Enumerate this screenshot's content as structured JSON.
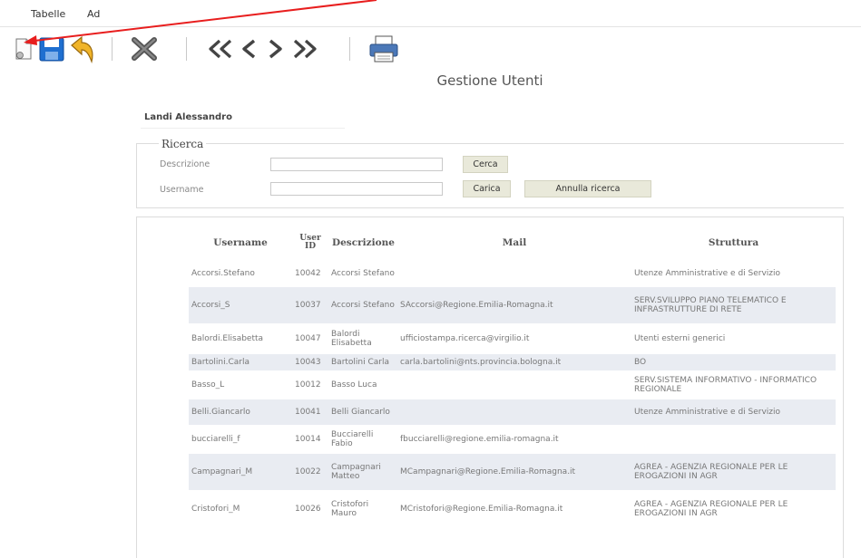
{
  "menu": {
    "item1": "Tabelle",
    "item2": "Ad"
  },
  "toolbar": {
    "new": "new-document-icon",
    "save": "save-icon",
    "undo": "undo-icon",
    "delete": "delete-icon",
    "first": "first-record-icon",
    "prev": "previous-record-icon",
    "next": "next-record-icon",
    "last": "last-record-icon",
    "print": "print-icon"
  },
  "page": {
    "title": "Gestione Utenti",
    "user": "Landi Alessandro"
  },
  "search": {
    "legend": "Ricerca",
    "desc_label": "Descrizione",
    "user_label": "Username",
    "desc_value": "",
    "user_value": "",
    "cerca": "Cerca",
    "carica": "Carica",
    "annulla": "Annulla ricerca"
  },
  "table": {
    "headers": {
      "username": "Username",
      "userid_1": "User",
      "userid_2": "ID",
      "descrizione": "Descrizione",
      "mail": "Mail",
      "struttura": "Struttura"
    },
    "rows": [
      {
        "username": "Accorsi.Stefano",
        "id": "10042",
        "desc": "Accorsi Stefano",
        "mail": "",
        "str": "Utenze Amministrative e di Servizio"
      },
      {
        "username": "Accorsi_S",
        "id": "10037",
        "desc": "Accorsi Stefano",
        "mail": "SAccorsi@Regione.Emilia-Romagna.it",
        "str": "SERV.SVILUPPO PIANO TELEMATICO E INFRASTRUTTURE DI RETE"
      },
      {
        "username": "Balordi.Elisabetta",
        "id": "10047",
        "desc": "Balordi Elisabetta",
        "mail": "ufficiostampa.ricerca@virgilio.it",
        "str": "Utenti esterni generici"
      },
      {
        "username": "Bartolini.Carla",
        "id": "10043",
        "desc": "Bartolini Carla",
        "mail": "carla.bartolini@nts.provincia.bologna.it",
        "str": "BO"
      },
      {
        "username": "Basso_L",
        "id": "10012",
        "desc": "Basso Luca",
        "mail": "",
        "str": "SERV.SISTEMA INFORMATIVO - INFORMATICO REGIONALE"
      },
      {
        "username": "Belli.Giancarlo",
        "id": "10041",
        "desc": "Belli Giancarlo",
        "mail": "",
        "str": "Utenze Amministrative e di Servizio"
      },
      {
        "username": "bucciarelli_f",
        "id": "10014",
        "desc": "Bucciarelli Fabio",
        "mail": "fbucciarelli@regione.emilia-romagna.it",
        "str": ""
      },
      {
        "username": "Campagnari_M",
        "id": "10022",
        "desc": "Campagnari Matteo",
        "mail": "MCampagnari@Regione.Emilia-Romagna.it",
        "str": "AGREA - AGENZIA REGIONALE PER LE EROGAZIONI IN AGR"
      },
      {
        "username": "Cristofori_M",
        "id": "10026",
        "desc": "Cristofori Mauro",
        "mail": "MCristofori@Regione.Emilia-Romagna.it",
        "str": "AGREA - AGENZIA REGIONALE PER LE EROGAZIONI IN AGR"
      }
    ]
  },
  "colors": {
    "arrow": "#e81e1e",
    "row_alt": "#e9ecf2",
    "button_bg": "#e9e9da",
    "save_blue": "#1f6fd0",
    "undo_yellow": "#f0b429"
  }
}
